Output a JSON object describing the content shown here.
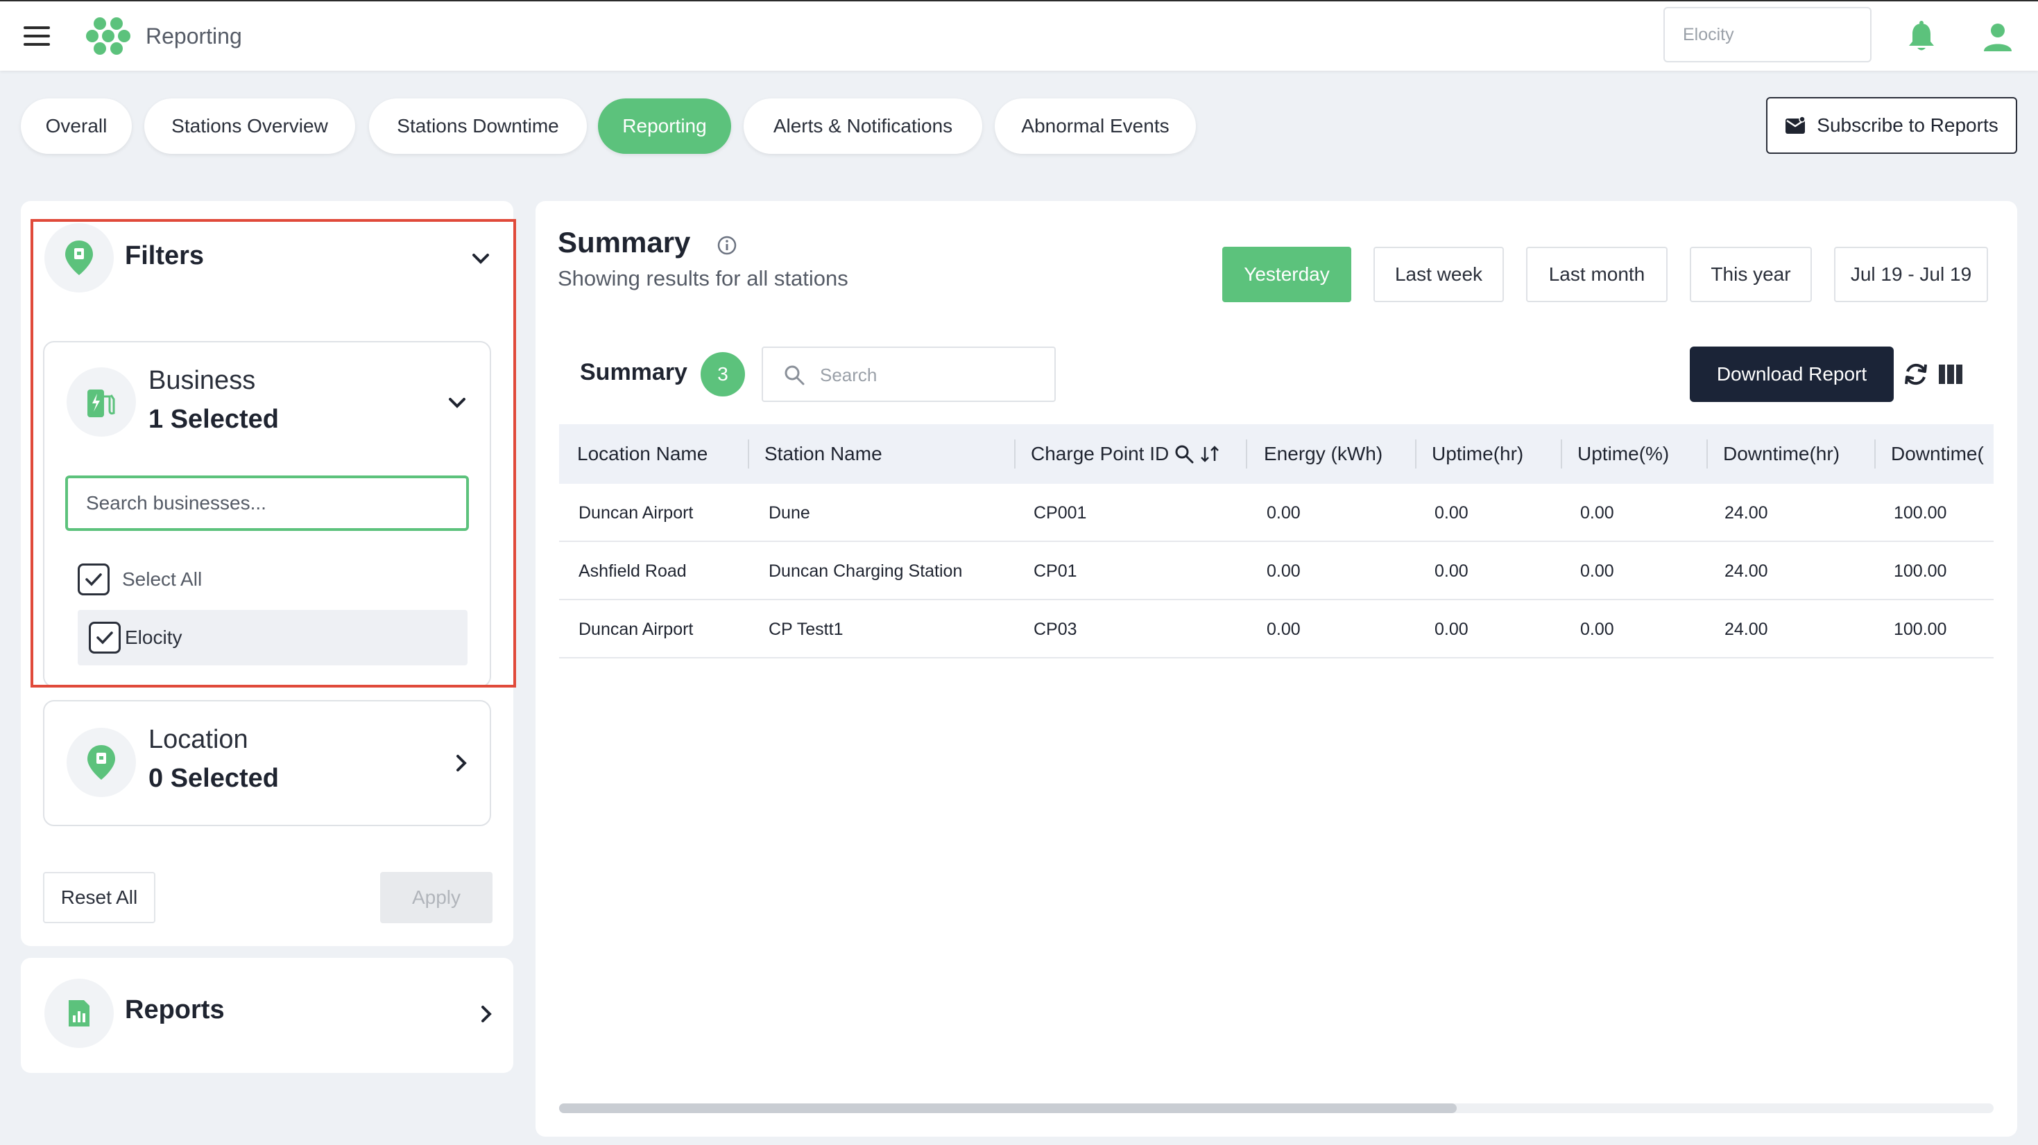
{
  "app": {
    "title": "Reporting",
    "org_select": "Elocity",
    "accent_color": "#5cc27c",
    "icons": [
      "menu-icon",
      "logo-icon",
      "bell-icon",
      "user-icon"
    ]
  },
  "tabs": [
    {
      "label": "Overall"
    },
    {
      "label": "Stations Overview"
    },
    {
      "label": "Stations Downtime"
    },
    {
      "label": "Reporting",
      "active": true
    },
    {
      "label": "Alerts & Notifications"
    },
    {
      "label": "Abnormal Events"
    }
  ],
  "subscribe_label": "Subscribe to Reports",
  "filters": {
    "title": "Filters",
    "business": {
      "title": "Business",
      "selected": "1 Selected",
      "search_placeholder": "Search businesses...",
      "select_all": "Select All",
      "option": "Elocity"
    },
    "location": {
      "title": "Location",
      "selected": "0 Selected"
    },
    "reset_label": "Reset All",
    "apply_label": "Apply"
  },
  "reports": {
    "title": "Reports"
  },
  "summary": {
    "title": "Summary",
    "subtitle": "Showing results for all stations",
    "ranges": [
      "Yesterday",
      "Last week",
      "Last month",
      "This year",
      "Jul 19 - Jul 19"
    ],
    "active_range": "Yesterday",
    "table_title": "Summary",
    "count": "3",
    "search_placeholder": "Search",
    "download_label": "Download Report"
  },
  "table": {
    "columns": [
      "Location Name",
      "Station Name",
      "Charge Point ID",
      "Energy (kWh)",
      "Uptime(hr)",
      "Uptime(%)",
      "Downtime(hr)",
      "Downtime("
    ],
    "rows": [
      [
        "Duncan Airport",
        "Dune",
        "CP001",
        "0.00",
        "0.00",
        "0.00",
        "24.00",
        "100.00"
      ],
      [
        "Ashfield Road",
        "Duncan Charging Station",
        "CP01",
        "0.00",
        "0.00",
        "0.00",
        "24.00",
        "100.00"
      ],
      [
        "Duncan Airport",
        "CP Testt1",
        "CP03",
        "0.00",
        "0.00",
        "0.00",
        "24.00",
        "100.00"
      ]
    ]
  }
}
